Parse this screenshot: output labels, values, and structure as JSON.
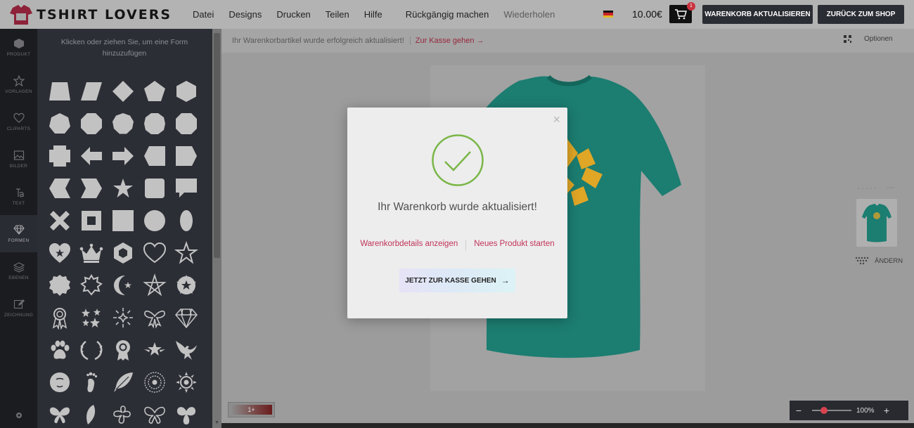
{
  "brand": {
    "name": "TSHIRT LOVERS",
    "accent_color": "#97273c"
  },
  "menu": [
    {
      "label": "Datei"
    },
    {
      "label": "Designs"
    },
    {
      "label": "Drucken"
    },
    {
      "label": "Teilen"
    },
    {
      "label": "Hilfe"
    },
    {
      "label": "Rückgängig machen"
    },
    {
      "label": "Wiederholen",
      "disabled": true
    }
  ],
  "header": {
    "language_icon": "german-flag-icon",
    "price": "10.00€",
    "cart_count": "1",
    "update_cart_label": "WARENKORB AKTUALISIEREN",
    "back_to_shop_label": "ZURÜCK ZUM SHOP"
  },
  "rail": {
    "items": [
      {
        "label": "PRODUKT",
        "icon": "box-icon"
      },
      {
        "label": "VORLAGEN",
        "icon": "star-icon"
      },
      {
        "label": "CLIPARTS",
        "icon": "heart-icon"
      },
      {
        "label": "BILDER",
        "icon": "image-icon"
      },
      {
        "label": "TEXT",
        "icon": "text-icon"
      },
      {
        "label": "FORMEN",
        "icon": "diamond-icon",
        "active": true
      },
      {
        "label": "EBENEN",
        "icon": "layers-icon"
      },
      {
        "label": "ZEICHNUNG",
        "icon": "pencil-icon"
      }
    ]
  },
  "shapes_panel": {
    "hint": "Klicken oder ziehen Sie, um eine Form hinzuzufügen"
  },
  "notice": {
    "message": "Ihr Warenkorbartikel wurde erfolgreich aktualisiert!",
    "link": "Zur Kasse gehen"
  },
  "toolbar": {
    "options_label": "Optionen"
  },
  "side_views": {
    "change_label": "ÄNDERN"
  },
  "layer_chip": {
    "label": "1+"
  },
  "zoom": {
    "value": "100%",
    "minus": "−",
    "plus": "+"
  },
  "modal": {
    "title": "Ihr Warenkorb wurde aktualisiert!",
    "view_cart_link": "Warenkorbdetails anzeigen",
    "new_product_link": "Neues Produkt starten",
    "checkout_button": "JETZT ZUR KASSE GEHEN",
    "close_symbol": "×",
    "success_color": "#7ab648",
    "link_color": "#c1335a"
  },
  "product": {
    "tshirt_color": "#1c7d71",
    "print_color": "#e0a626"
  }
}
